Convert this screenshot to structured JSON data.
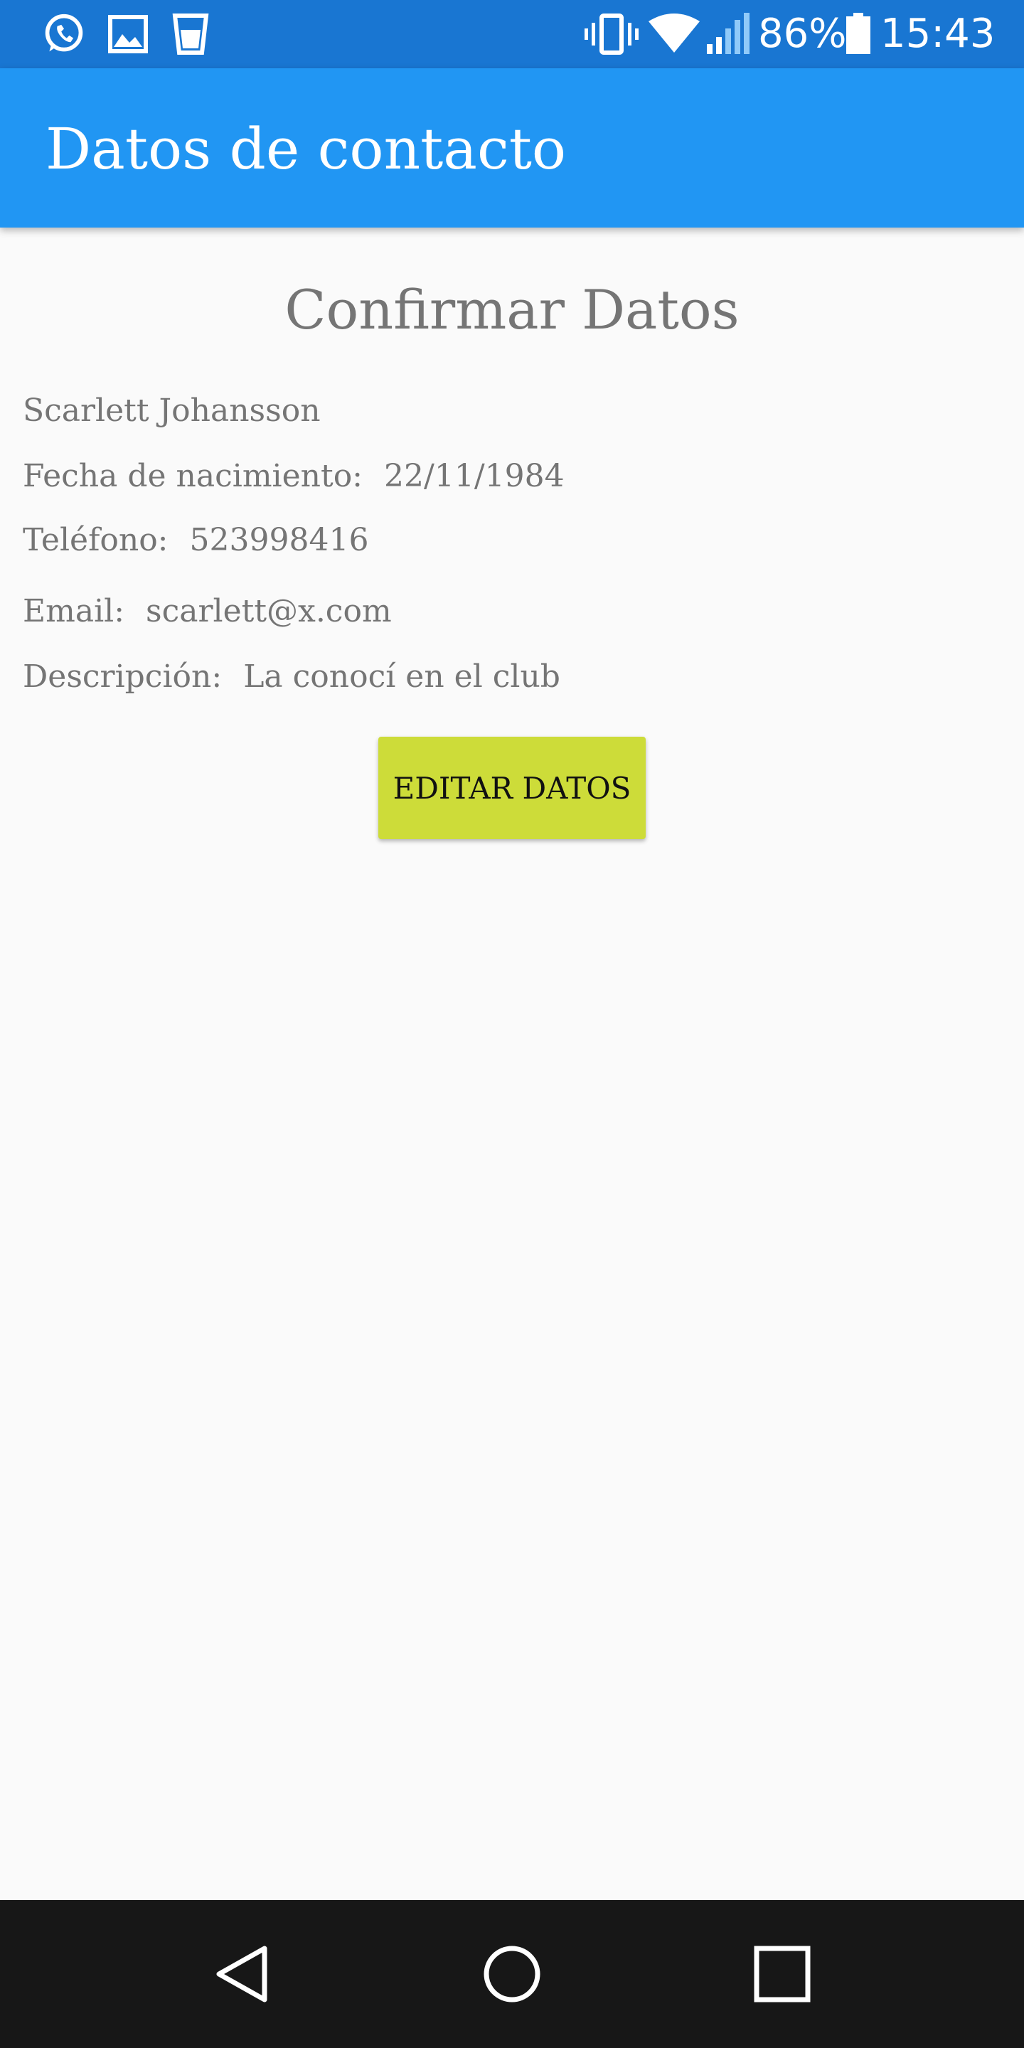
{
  "status_bar": {
    "notification_icons": [
      "whatsapp-icon",
      "gallery-icon",
      "cup-icon"
    ],
    "system_icons": [
      "vibrate-icon",
      "wifi-icon",
      "signal-icon",
      "battery-icon"
    ],
    "battery_percent": "86%",
    "time": "15:43"
  },
  "app_bar": {
    "title": "Datos de contacto"
  },
  "main": {
    "heading": "Confirmar Datos",
    "name": "Scarlett Johansson",
    "fields": [
      {
        "label": "Fecha de nacimiento:",
        "value": "22/11/1984"
      },
      {
        "label": "Teléfono:",
        "value": "523998416"
      },
      {
        "label": "Email:",
        "value": "scarlett@x.com"
      },
      {
        "label": "Descripción:",
        "value": "La conocí en el club"
      }
    ],
    "edit_button_label": "EDITAR DATOS"
  },
  "nav_bar": {
    "buttons": [
      "back-icon",
      "home-icon",
      "recents-icon"
    ]
  },
  "colors": {
    "status_bar": "#1976d2",
    "app_bar": "#2196f3",
    "button": "#cddc39",
    "text_secondary": "#757575",
    "nav_bar": "#171717"
  }
}
